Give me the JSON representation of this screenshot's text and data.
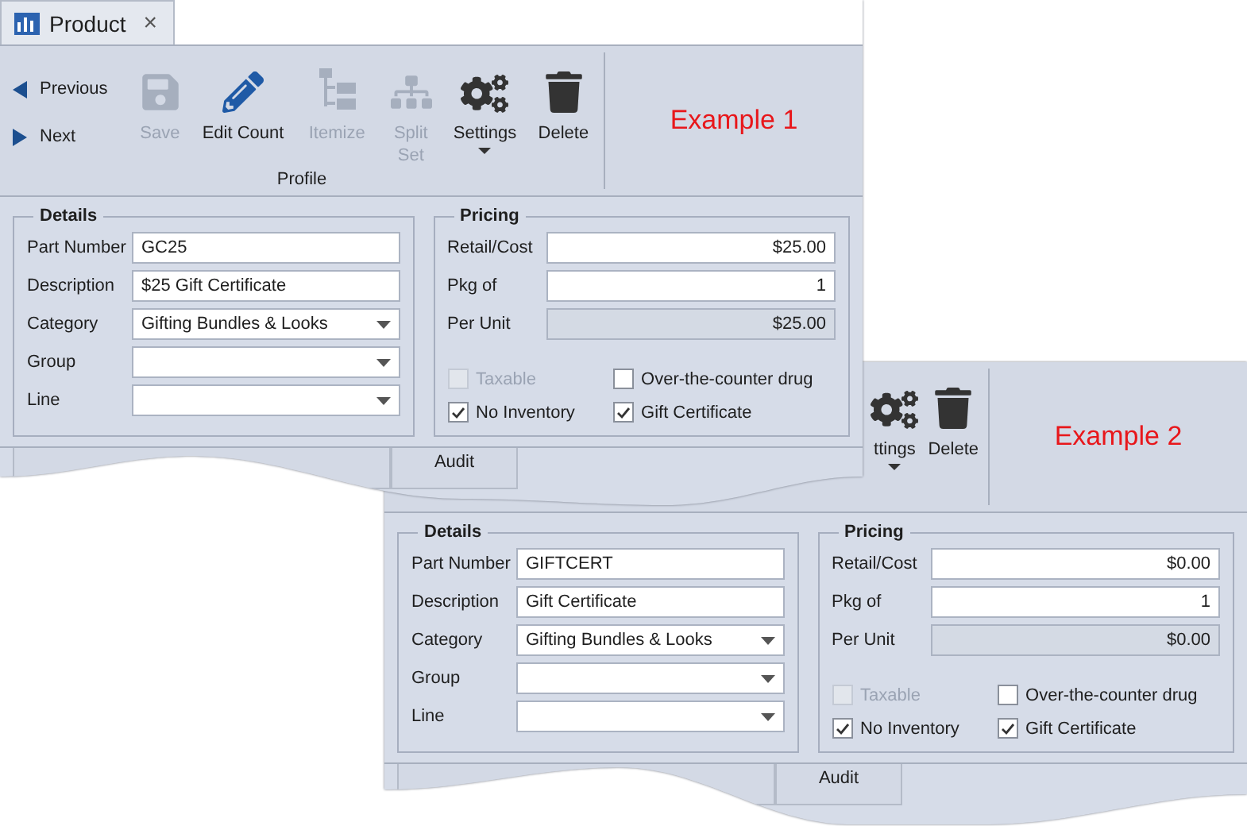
{
  "windows": [
    {
      "tab": {
        "title": "Product",
        "close": "×"
      },
      "toolbar": {
        "nav": [
          {
            "kind": "previous",
            "label": "Previous"
          },
          {
            "kind": "next",
            "label": "Next"
          }
        ],
        "buttons": [
          {
            "kind": "save",
            "label": "Save",
            "disabled": true
          },
          {
            "kind": "edit",
            "label": "Edit Count",
            "disabled": false
          },
          {
            "kind": "itemize",
            "label": "Itemize",
            "disabled": true
          },
          {
            "kind": "split",
            "label": "Split Set",
            "disabled": true
          },
          {
            "kind": "settings",
            "label": "Settings",
            "disabled": false
          },
          {
            "kind": "delete",
            "label": "Delete",
            "disabled": false
          }
        ],
        "group_label": "Profile"
      },
      "example_label": "Example 1",
      "details": {
        "title": "Details",
        "fields": [
          {
            "kind": "text",
            "label": "Part Number",
            "value": "GC25"
          },
          {
            "kind": "text",
            "label": "Description",
            "value": "$25 Gift Certificate"
          },
          {
            "kind": "dropdown",
            "label": "Category",
            "value": "Gifting Bundles & Looks"
          },
          {
            "kind": "dropdown",
            "label": "Group"
          },
          {
            "kind": "dropdown",
            "label": "Line"
          }
        ]
      },
      "pricing": {
        "title": "Pricing",
        "fields": [
          {
            "kind": "text",
            "label": "Retail/Cost",
            "value": "$25.00"
          },
          {
            "kind": "text",
            "label": "Pkg of",
            "value": "1"
          },
          {
            "kind": "readonly",
            "label": "Per Unit",
            "value": "$25.00"
          }
        ],
        "options": [
          {
            "label": "Taxable",
            "checked": false,
            "disabled": true
          },
          {
            "label": "Over-the-counter drug",
            "checked": false,
            "disabled": false
          },
          {
            "label": "No Inventory",
            "checked": true,
            "disabled": false
          },
          {
            "label": "Gift Certificate",
            "checked": true,
            "disabled": false
          }
        ]
      },
      "bottom_tabs": [
        {
          "label": "Audit"
        }
      ]
    },
    {
      "toolbar": {
        "buttons": [
          {
            "kind": "settings",
            "label": "ttings",
            "disabled": false
          },
          {
            "kind": "delete",
            "label": "Delete",
            "disabled": false
          }
        ]
      },
      "example_label": "Example 2",
      "details": {
        "title": "Details",
        "fields": [
          {
            "kind": "text",
            "label": "Part Number",
            "value": "GIFTCERT"
          },
          {
            "kind": "text",
            "label": "Description",
            "value": "Gift Certificate"
          },
          {
            "kind": "dropdown",
            "label": "Category",
            "value": "Gifting Bundles & Looks"
          },
          {
            "kind": "dropdown",
            "label": "Group"
          },
          {
            "kind": "dropdown",
            "label": "Line"
          }
        ]
      },
      "pricing": {
        "title": "Pricing",
        "fields": [
          {
            "kind": "text",
            "label": "Retail/Cost",
            "value": "$0.00"
          },
          {
            "kind": "text",
            "label": "Pkg of",
            "value": "1"
          },
          {
            "kind": "readonly",
            "label": "Per Unit",
            "value": "$0.00"
          }
        ],
        "options": [
          {
            "label": "Taxable",
            "checked": false,
            "disabled": true
          },
          {
            "label": "Over-the-counter drug",
            "checked": false,
            "disabled": false
          },
          {
            "label": "No Inventory",
            "checked": true,
            "disabled": false
          },
          {
            "label": "Gift Certificate",
            "checked": true,
            "disabled": false
          }
        ]
      },
      "bottom_tabs": [
        {
          "label": "Audit"
        }
      ]
    }
  ]
}
